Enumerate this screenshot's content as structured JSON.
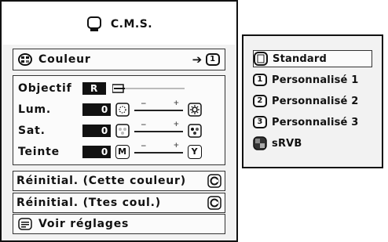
{
  "title": "C.M.S.",
  "couleur_row": {
    "label": "Couleur",
    "arrow": "➔",
    "channel_number": "1"
  },
  "settings": {
    "objectif": {
      "label": "Objectif",
      "value": "R"
    },
    "lum": {
      "label": "Lum.",
      "value": "0"
    },
    "sat": {
      "label": "Sat.",
      "value": "0"
    },
    "teinte": {
      "label": "Teinte",
      "value": "0",
      "left_icon_letter": "M",
      "right_icon_letter": "Y"
    },
    "slider_minus": "−",
    "slider_plus": "+"
  },
  "reset_color_label": "Réinitial. (Cette couleur)",
  "reset_all_label": "Réinitial. (Ttes coul.)",
  "view_settings_label": "Voir réglages",
  "submenu": {
    "items": [
      {
        "label": "Standard",
        "icon": "standard-icon"
      },
      {
        "label": "Personnalisé 1",
        "number": "1"
      },
      {
        "label": "Personnalisé 2",
        "number": "2"
      },
      {
        "label": "Personnalisé 3",
        "number": "3"
      },
      {
        "label": "sRVB",
        "icon": "srgb-icon"
      }
    ]
  }
}
